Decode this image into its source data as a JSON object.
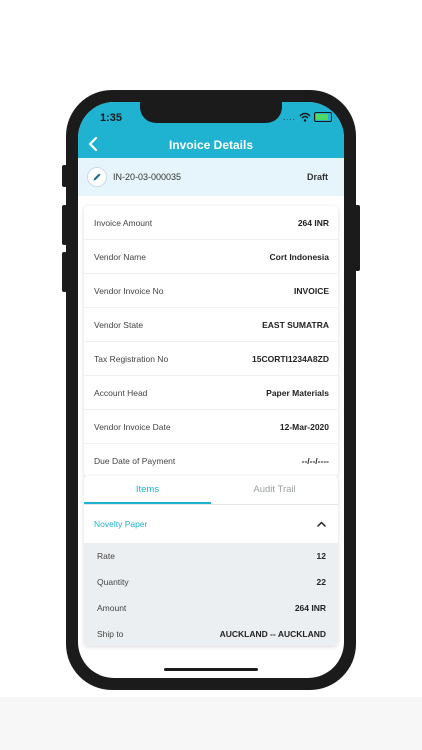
{
  "status_bar": {
    "time": "1:35",
    "dots": "...."
  },
  "header": {
    "title": "Invoice Details"
  },
  "invoice": {
    "number": "IN-20-03-000035",
    "status": "Draft"
  },
  "details": [
    {
      "label": "Invoice Amount",
      "value": "264 INR"
    },
    {
      "label": "Vendor Name",
      "value": "Cort Indonesia"
    },
    {
      "label": "Vendor Invoice No",
      "value": "INVOICE"
    },
    {
      "label": "Vendor State",
      "value": "EAST SUMATRA"
    },
    {
      "label": "Tax Registration No",
      "value": "15CORTI1234A8ZD"
    },
    {
      "label": "Account Head",
      "value": "Paper Materials"
    },
    {
      "label": "Vendor Invoice Date",
      "value": "12-Mar-2020"
    },
    {
      "label": "Due Date of Payment",
      "value": "--/--/----"
    }
  ],
  "tabs": {
    "items": "Items",
    "audit_trail": "Audit Trail"
  },
  "item": {
    "name": "Novelty Paper",
    "rows": [
      {
        "label": "Rate",
        "value": "12"
      },
      {
        "label": "Quantity",
        "value": "22"
      },
      {
        "label": "Amount",
        "value": "264 INR"
      },
      {
        "label": "Ship to",
        "value": "AUCKLAND -- AUCKLAND"
      }
    ]
  },
  "colors": {
    "accent": "#1fb2d1",
    "invoice_bar": "#e6f4fb",
    "item_detail_bg": "#eceff1"
  },
  "icons": [
    "back-icon",
    "edit-icon",
    "wifi-icon",
    "battery-icon",
    "chevron-up-icon"
  ]
}
